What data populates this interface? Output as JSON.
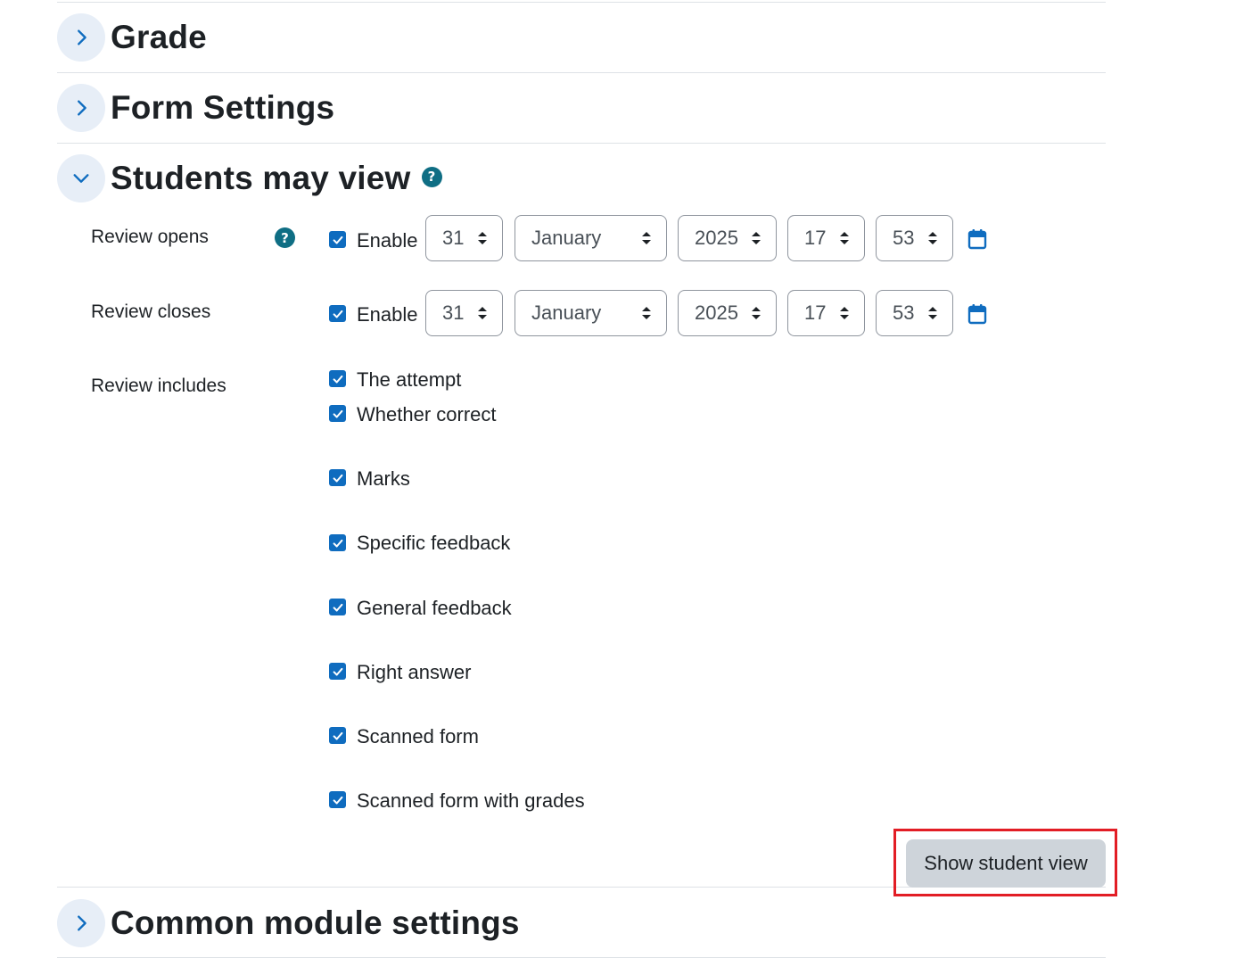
{
  "sections": {
    "grade": {
      "title": "Grade",
      "expanded": false
    },
    "form_settings": {
      "title": "Form Settings",
      "expanded": false
    },
    "students_may_view": {
      "title": "Students may view",
      "expanded": true
    },
    "common_module_settings": {
      "title": "Common module settings",
      "expanded": false
    }
  },
  "review_opens": {
    "label": "Review opens",
    "enable_label": "Enable",
    "enabled": true,
    "day": "31",
    "month": "January",
    "year": "2025",
    "hour": "17",
    "minute": "53"
  },
  "review_closes": {
    "label": "Review closes",
    "enable_label": "Enable",
    "enabled": true,
    "day": "31",
    "month": "January",
    "year": "2025",
    "hour": "17",
    "minute": "53"
  },
  "review_includes": {
    "label": "Review includes",
    "options": [
      {
        "label": "The attempt",
        "checked": true
      },
      {
        "label": "Whether correct",
        "checked": true
      },
      {
        "label": "Marks",
        "checked": true
      },
      {
        "label": "Specific feedback",
        "checked": true
      },
      {
        "label": "General feedback",
        "checked": true
      },
      {
        "label": "Right answer",
        "checked": true
      },
      {
        "label": "Scanned form",
        "checked": true
      },
      {
        "label": "Scanned form with grades",
        "checked": true
      }
    ]
  },
  "actions": {
    "show_student_view": "Show student view"
  },
  "help_glyph": "?",
  "colors": {
    "accent": "#0f6cbf",
    "help": "#0f6e84",
    "toggle_bg": "#e7eef7",
    "button_bg": "#ced4da",
    "highlight": "#e21d25"
  }
}
